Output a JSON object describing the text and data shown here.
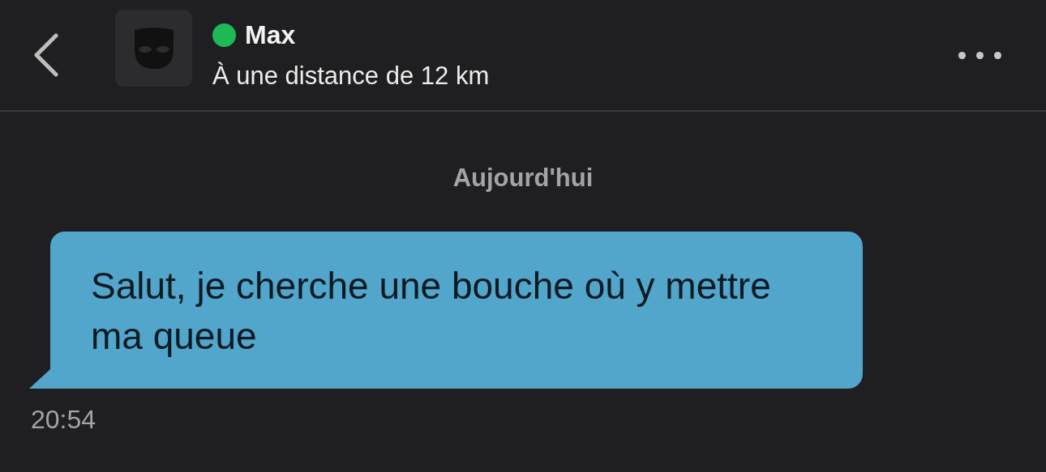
{
  "header": {
    "contact": {
      "name": "Max",
      "online": true,
      "distance": "À une distance de 12 km"
    }
  },
  "date_separator": "Aujourd'hui",
  "messages": [
    {
      "text": "Salut, je cherche une bouche où y mettre ma queue",
      "time": "20:54"
    }
  ]
}
